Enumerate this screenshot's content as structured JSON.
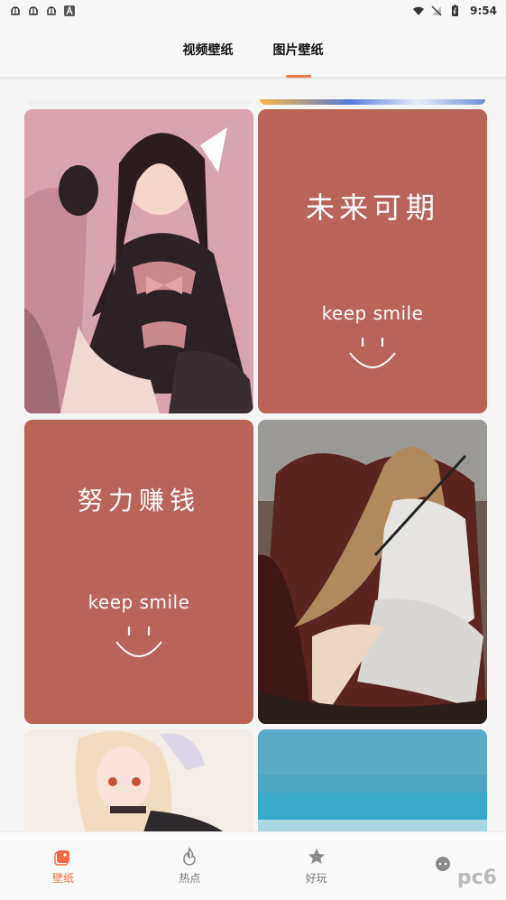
{
  "status_bar": {
    "time": "9:54",
    "notif_icons": [
      "bug-icon",
      "bug-icon",
      "bug-icon",
      "a-icon"
    ]
  },
  "tabs": [
    {
      "label": "视频壁纸",
      "active": false
    },
    {
      "label": "图片壁纸",
      "active": true
    }
  ],
  "cards": {
    "card2": {
      "headline": "未来可期",
      "sub": "keep smile"
    },
    "card3": {
      "headline": "努力赚钱",
      "sub": "keep smile"
    }
  },
  "nav": [
    {
      "label": "壁纸",
      "icon": "wallpaper-icon",
      "active": true
    },
    {
      "label": "热点",
      "icon": "flame-icon",
      "active": false
    },
    {
      "label": "好玩",
      "icon": "star-icon",
      "active": false
    },
    {
      "label": "",
      "icon": "chat-icon",
      "active": false
    }
  ],
  "colors": {
    "accent": "#ef6a3f",
    "card": "#b86558"
  },
  "watermark": "pc6"
}
